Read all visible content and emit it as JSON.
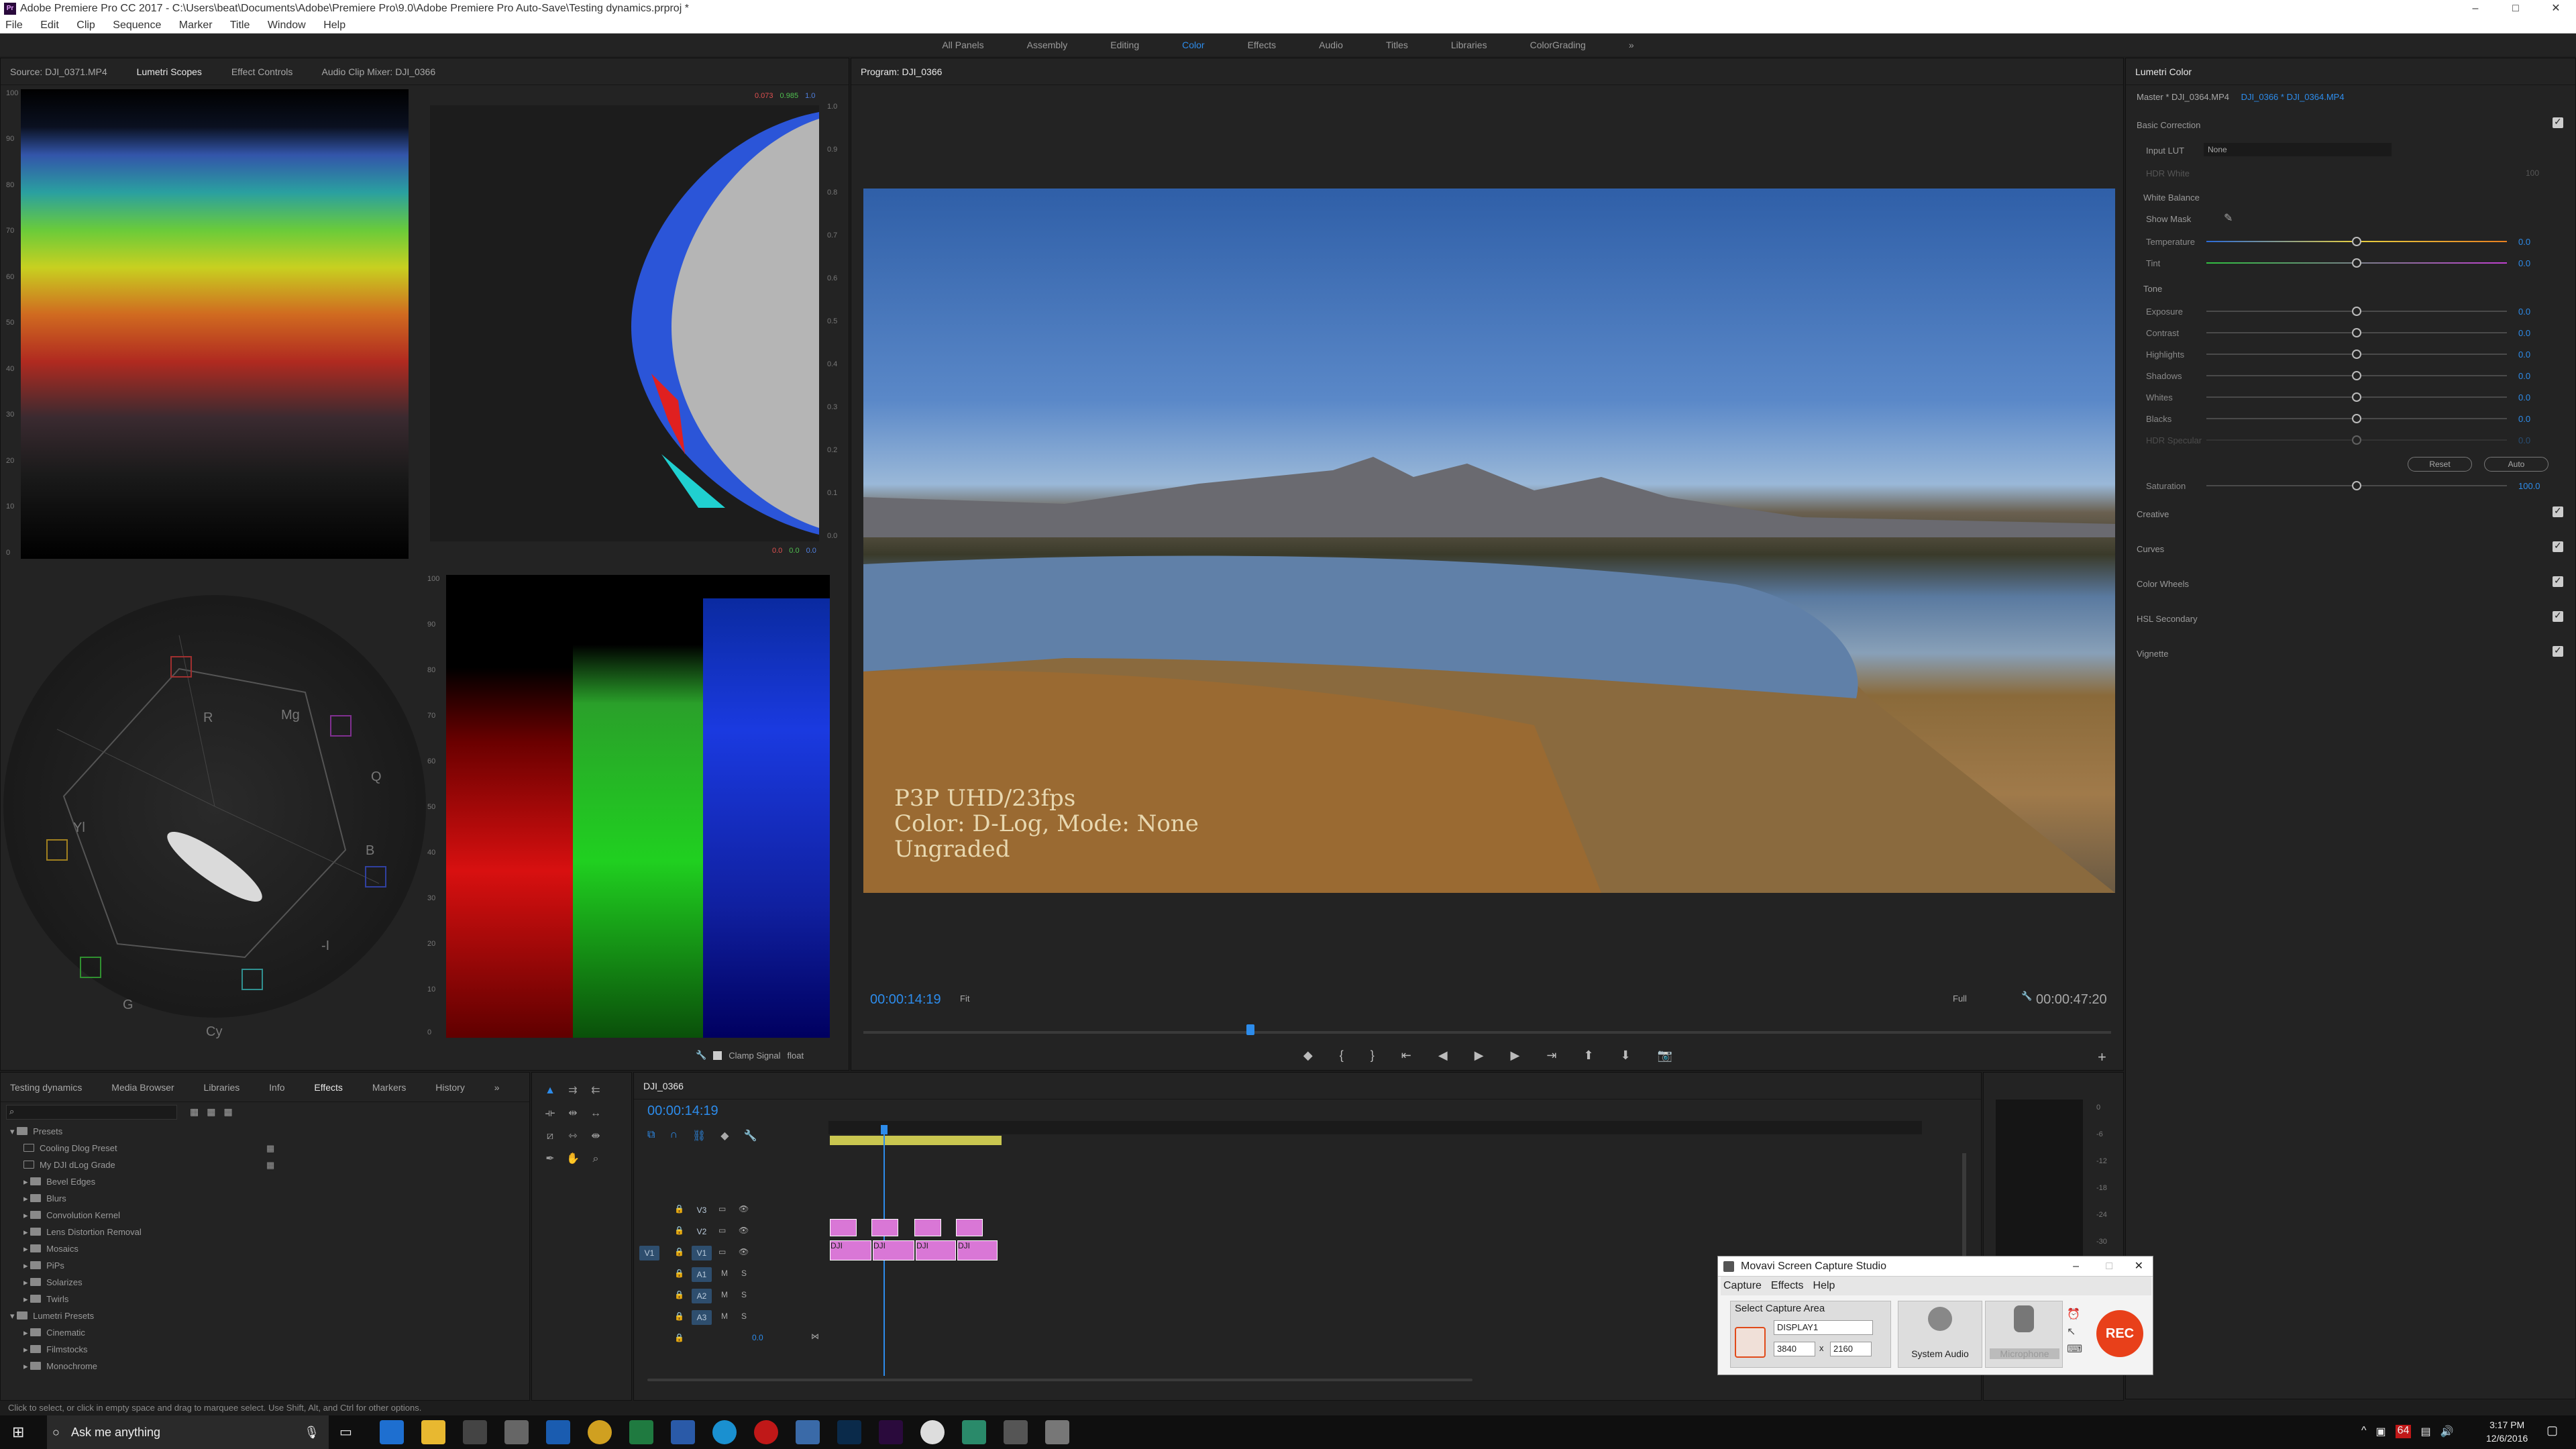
{
  "title_bar": {
    "title": "Adobe Premiere Pro CC 2017 - C:\\Users\\beat\\Documents\\Adobe\\Premiere Pro\\9.0\\Adobe Premiere Pro Auto-Save\\Testing dynamics.prproj *",
    "minimize": "–",
    "maximize": "□",
    "close": "✕"
  },
  "menu": [
    "File",
    "Edit",
    "Clip",
    "Sequence",
    "Marker",
    "Title",
    "Window",
    "Help"
  ],
  "workspaces": [
    "All Panels",
    "Assembly",
    "Editing",
    "Color",
    "Effects",
    "Audio",
    "Titles",
    "Libraries",
    "ColorGrading"
  ],
  "workspace_active": "Color",
  "workspace_more": "»",
  "source_panel": {
    "tabs": [
      "Source: DJI_0371.MP4",
      "Lumetri Scopes",
      "Effect Controls",
      "Audio Clip Mixer: DJI_0366"
    ],
    "active_tab": "Lumetri Scopes",
    "wave_scale": [
      "100",
      "90",
      "80",
      "70",
      "60",
      "50",
      "40",
      "30",
      "20",
      "10",
      "0"
    ],
    "hist_scale": [
      "1.0",
      "0.9",
      "0.8",
      "0.7",
      "0.6",
      "0.5",
      "0.4",
      "0.3",
      "0.2",
      "0.1",
      "0.0"
    ],
    "vector_labels": {
      "r": "R",
      "mg": "Mg",
      "b": "B",
      "cy": "Cy",
      "g": "G",
      "yl": "Yl",
      "q": "Q",
      "i": "-I"
    },
    "hist_top_vals": [
      "0.073",
      "0.985",
      "1.0"
    ],
    "hist_bot_vals": [
      "0.0",
      "0.0",
      "0.0"
    ],
    "clamp_signal": "Clamp Signal",
    "float_label": "float"
  },
  "program_panel": {
    "tab": "Program: DJI_0366",
    "overlay_line1": "P3P UHD/23fps",
    "overlay_line2": "Color: D-Log, Mode: None",
    "overlay_line3": "Ungraded",
    "timecode_left": "00:00:14:19",
    "fit": "Fit",
    "resolution": "Full",
    "timecode_right": "00:00:47:20",
    "playhead_fraction": 0.31
  },
  "lumetri": {
    "tab": "Lumetri Color",
    "master": "Master * DJI_0364.MP4",
    "clip": "DJI_0366 * DJI_0364.MP4",
    "basic_correction": "Basic Correction",
    "input_lut_label": "Input LUT",
    "input_lut_value": "None",
    "hdr_white": "HDR White",
    "hdr_white_val": "100",
    "white_balance": "White Balance",
    "show_mask": "Show Mask",
    "tone": "Tone",
    "sliders_wb": [
      {
        "label": "Temperature",
        "value": "0.0"
      },
      {
        "label": "Tint",
        "value": "0.0"
      }
    ],
    "sliders_tone": [
      {
        "label": "Exposure",
        "value": "0.0"
      },
      {
        "label": "Contrast",
        "value": "0.0"
      },
      {
        "label": "Highlights",
        "value": "0.0"
      },
      {
        "label": "Shadows",
        "value": "0.0"
      },
      {
        "label": "Whites",
        "value": "0.0"
      },
      {
        "label": "Blacks",
        "value": "0.0"
      },
      {
        "label": "HDR Specular",
        "value": "0.0"
      }
    ],
    "reset": "Reset",
    "auto": "Auto",
    "saturation_label": "Saturation",
    "saturation_value": "100.0",
    "sections": [
      "Creative",
      "Curves",
      "Color Wheels",
      "HSL Secondary",
      "Vignette"
    ]
  },
  "project_panel": {
    "tabs": [
      "Testing dynamics",
      "Media Browser",
      "Libraries",
      "Info",
      "Effects",
      "Markers",
      "History"
    ],
    "active_tab": "Effects",
    "more": "»",
    "tree": [
      {
        "label": "Presets",
        "level": 0,
        "open": true
      },
      {
        "label": "Cooling Dlog Preset",
        "level": 1,
        "file": true
      },
      {
        "label": "My DJI dLog Grade",
        "level": 1,
        "file": true
      },
      {
        "label": "Bevel Edges",
        "level": 1
      },
      {
        "label": "Blurs",
        "level": 1
      },
      {
        "label": "Convolution Kernel",
        "level": 1
      },
      {
        "label": "Lens Distortion Removal",
        "level": 1
      },
      {
        "label": "Mosaics",
        "level": 1
      },
      {
        "label": "PiPs",
        "level": 1
      },
      {
        "label": "Solarizes",
        "level": 1
      },
      {
        "label": "Twirls",
        "level": 1
      },
      {
        "label": "Lumetri Presets",
        "level": 0,
        "open": true
      },
      {
        "label": "Cinematic",
        "level": 1
      },
      {
        "label": "Filmstocks",
        "level": 1
      },
      {
        "label": "Monochrome",
        "level": 1
      }
    ]
  },
  "timeline": {
    "tab": "DJI_0366",
    "timecode": "00:00:14:19",
    "tracks_video": [
      "V3",
      "V2",
      "V1"
    ],
    "tracks_audio": [
      "A1",
      "A2",
      "A3"
    ],
    "source_patch": "V1",
    "master_val": "0.0",
    "clips": [
      "DJI",
      "DJI",
      "DJI",
      "DJI"
    ],
    "meter_scale": [
      "0",
      "-6",
      "-12",
      "-18",
      "-24",
      "-30"
    ]
  },
  "movavi": {
    "title": "Movavi Screen Capture Studio",
    "menu": [
      "Capture",
      "Effects",
      "Help"
    ],
    "select_area": "Select Capture Area",
    "display": "DISPLAY1",
    "width": "3840",
    "times": "x",
    "height": "2160",
    "system_audio": "System Audio",
    "microphone": "Microphone",
    "rec": "REC"
  },
  "status_bar": "Click to select, or click in empty space and drag to marquee select. Use Shift, Alt, and Ctrl for other options.",
  "taskbar": {
    "search": "Ask me anything",
    "time": "3:17 PM",
    "date": "12/6/2016",
    "badge": "64"
  }
}
